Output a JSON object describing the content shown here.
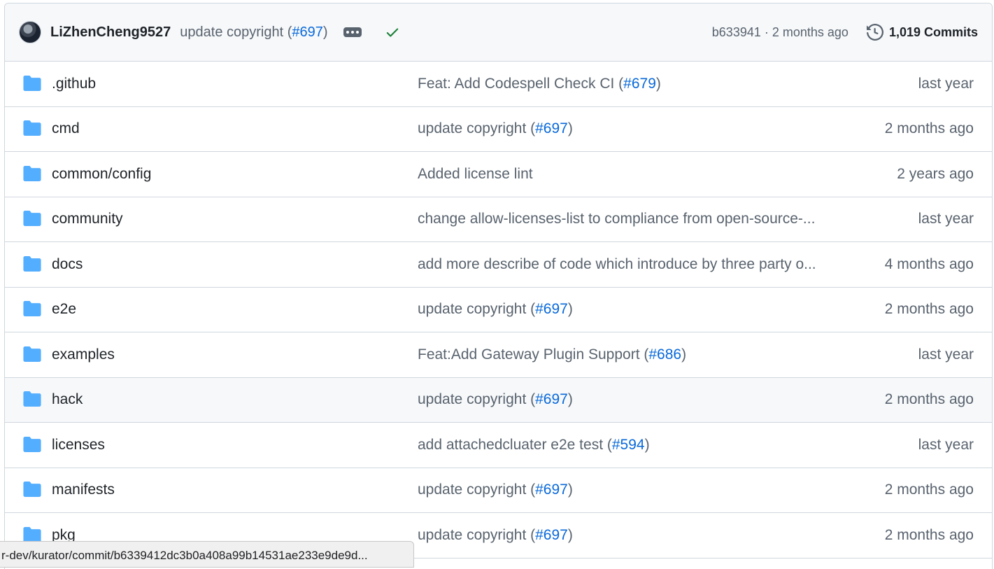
{
  "header": {
    "author": "LiZhenCheng9527",
    "message_prefix": "update copyright (",
    "message_link": "#697",
    "message_suffix": ")",
    "sha_time": "b633941 · 2 months ago",
    "commits": "1,019 Commits",
    "status": "success"
  },
  "files": [
    {
      "name": ".github",
      "msg_prefix": "Feat: Add Codespell Check CI (",
      "link": "#679",
      "msg_suffix": ")",
      "time": "last year"
    },
    {
      "name": "cmd",
      "msg_prefix": "update copyright (",
      "link": "#697",
      "msg_suffix": ")",
      "time": "2 months ago"
    },
    {
      "name": "common/config",
      "msg_prefix": "Added license lint",
      "link": "",
      "msg_suffix": "",
      "time": "2 years ago"
    },
    {
      "name": "community",
      "msg_prefix": "change allow-licenses-list to compliance from open-source-...",
      "link": "",
      "msg_suffix": "",
      "time": "last year"
    },
    {
      "name": "docs",
      "msg_prefix": "add more describe of code which introduce by three party o...",
      "link": "",
      "msg_suffix": "",
      "time": "4 months ago"
    },
    {
      "name": "e2e",
      "msg_prefix": "update copyright (",
      "link": "#697",
      "msg_suffix": ")",
      "time": "2 months ago"
    },
    {
      "name": "examples",
      "msg_prefix": "Feat:Add Gateway Plugin Support (",
      "link": "#686",
      "msg_suffix": ")",
      "time": "last year"
    },
    {
      "name": "hack",
      "msg_prefix": "update copyright (",
      "link": "#697",
      "msg_suffix": ")",
      "time": "2 months ago"
    },
    {
      "name": "licenses",
      "msg_prefix": "add attachedcluater e2e test (",
      "link": "#594",
      "msg_suffix": ")",
      "time": "last year"
    },
    {
      "name": "manifests",
      "msg_prefix": "update copyright (",
      "link": "#697",
      "msg_suffix": ")",
      "time": "2 months ago"
    },
    {
      "name": "pkg",
      "msg_prefix": "update copyright (",
      "link": "#697",
      "msg_suffix": ")",
      "time": "2 months ago"
    }
  ],
  "status_bar": {
    "url": "r-dev/kurator/commit/b6339412dc3b0a408a99b14531ae233e9de9d..."
  },
  "colors": {
    "link": "#0969da",
    "folder": "#54aeff",
    "success": "#1a7f37",
    "muted": "#59636e"
  }
}
